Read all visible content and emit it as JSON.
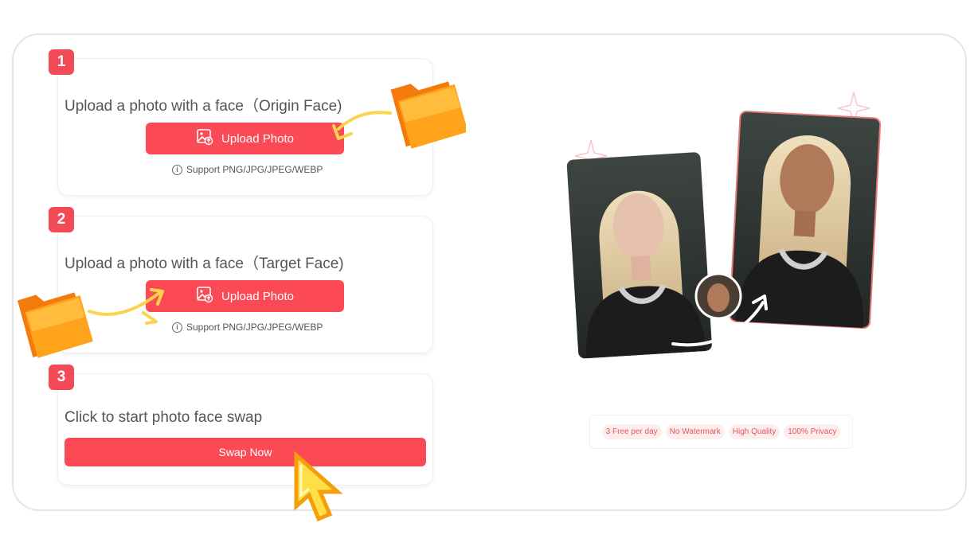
{
  "steps": [
    {
      "number": "1",
      "title": "Upload a photo with a face（Origin Face)",
      "button": "Upload Photo",
      "support": "Support PNG/JPG/JPEG/WEBP"
    },
    {
      "number": "2",
      "title": "Upload a photo with a face（Target Face)",
      "button": "Upload Photo",
      "support": "Support PNG/JPG/JPEG/WEBP"
    },
    {
      "number": "3",
      "title": "Click to start photo face swap",
      "button": "Swap Now"
    }
  ],
  "features": [
    "3 Free per day",
    "No Watermark",
    "High Quality",
    "100% Privacy"
  ],
  "colors": {
    "accent": "#fb4a56",
    "badge": "#f24a56",
    "pill_bg": "#fdeeee",
    "pill_text": "#e2555c"
  },
  "icons": {
    "upload": "image-upload-icon",
    "info": "info-icon",
    "folder": "folder-icon",
    "cursor": "pointer-cursor-icon"
  }
}
